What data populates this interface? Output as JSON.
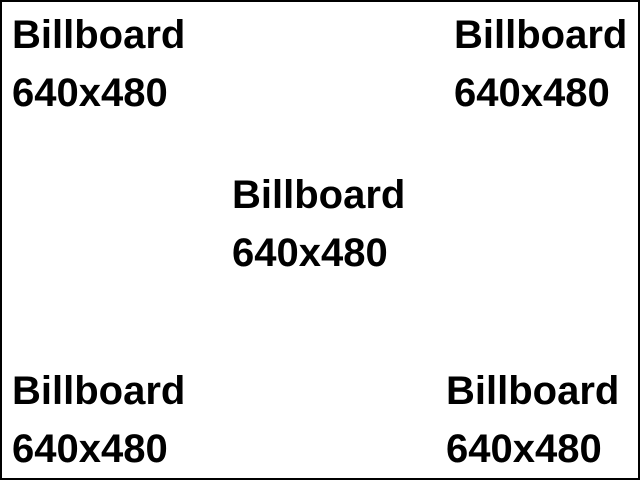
{
  "labels": {
    "top_left": {
      "title": "Billboard",
      "size": "640x480"
    },
    "top_right": {
      "title": "Billboard",
      "size": "640x480"
    },
    "center": {
      "title": "Billboard",
      "size": "640x480"
    },
    "bottom_left": {
      "title": "Billboard",
      "size": "640x480"
    },
    "bottom_right": {
      "title": "Billboard",
      "size": "640x480"
    }
  },
  "colors": {
    "background": "#ffffff",
    "text": "#000000",
    "border": "#000000"
  }
}
